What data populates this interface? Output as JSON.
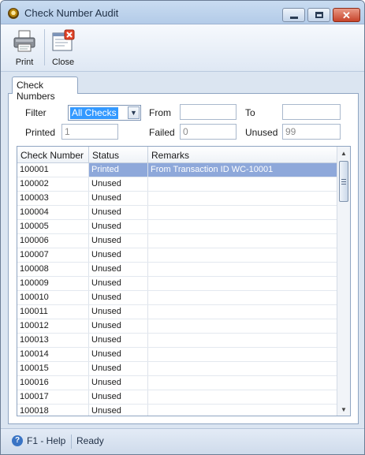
{
  "window": {
    "title": "Check Number Audit"
  },
  "toolbar": {
    "print_label": "Print",
    "close_label": "Close"
  },
  "tabs": [
    {
      "label": "Check Numbers"
    }
  ],
  "filter": {
    "filter_label": "Filter",
    "filter_value": "All Checks",
    "from_label": "From",
    "from_value": "",
    "to_label": "To",
    "to_value": "",
    "printed_label": "Printed",
    "printed_value": "1",
    "failed_label": "Failed",
    "failed_value": "0",
    "unused_label": "Unused",
    "unused_value": "99"
  },
  "grid": {
    "columns": [
      "Check Number",
      "Status",
      "Remarks"
    ],
    "rows": [
      [
        "100001",
        "Printed",
        "From Transaction ID WC-10001"
      ],
      [
        "100002",
        "Unused",
        ""
      ],
      [
        "100003",
        "Unused",
        ""
      ],
      [
        "100004",
        "Unused",
        ""
      ],
      [
        "100005",
        "Unused",
        ""
      ],
      [
        "100006",
        "Unused",
        ""
      ],
      [
        "100007",
        "Unused",
        ""
      ],
      [
        "100008",
        "Unused",
        ""
      ],
      [
        "100009",
        "Unused",
        ""
      ],
      [
        "100010",
        "Unused",
        ""
      ],
      [
        "100011",
        "Unused",
        ""
      ],
      [
        "100012",
        "Unused",
        ""
      ],
      [
        "100013",
        "Unused",
        ""
      ],
      [
        "100014",
        "Unused",
        ""
      ],
      [
        "100015",
        "Unused",
        ""
      ],
      [
        "100016",
        "Unused",
        ""
      ],
      [
        "100017",
        "Unused",
        ""
      ],
      [
        "100018",
        "Unused",
        ""
      ]
    ],
    "selected_row": 0
  },
  "status": {
    "help": "F1 - Help",
    "state": "Ready"
  }
}
